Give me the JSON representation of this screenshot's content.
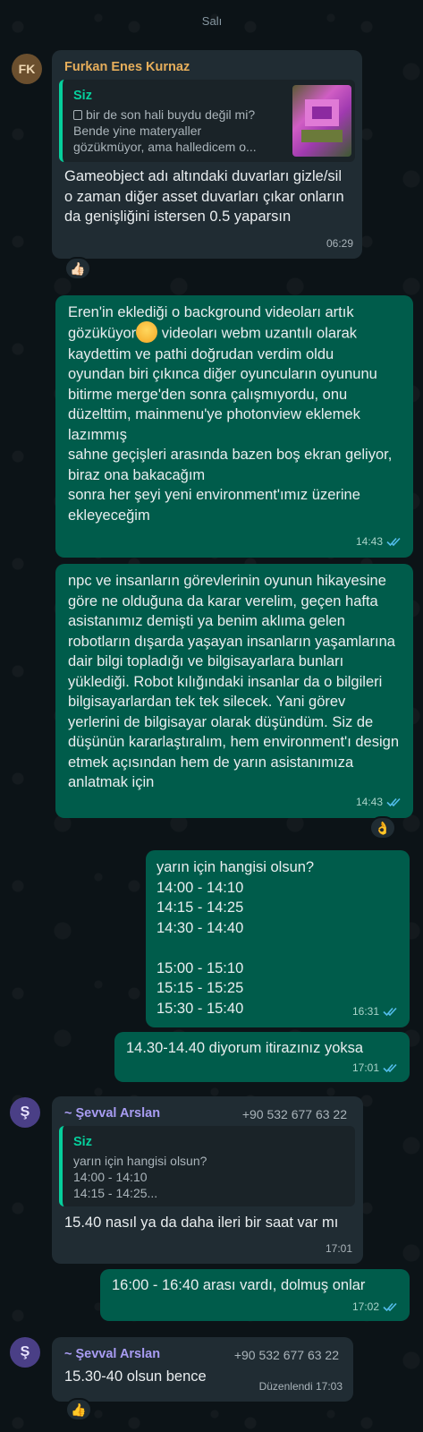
{
  "date_separator": "Salı",
  "colors": {
    "incoming": "#202c33",
    "outgoing": "#005c4b",
    "background": "#0c1317",
    "read_ticks": "#53bdeb"
  },
  "msg1": {
    "avatar_initials": "FK",
    "sender": "Furkan Enes Kurnaz",
    "quote": {
      "name": "Siz",
      "icon": "document-icon",
      "text": "bir de son hali buydu değil mi? Bende yine materyaller gözükmüyor, ama halledicem o..."
    },
    "text": "Gameobject adı altındaki duvarları gizle/sil o zaman diğer asset duvarları çıkar onların da genişliğini istersen 0.5 yaparsın",
    "time": "06:29",
    "reaction": "👍🏻"
  },
  "msg2": {
    "text_before_emoji": "Eren'in eklediği o background videoları artık gözüküyor",
    "text_after_emoji": " videoları webm uzantılı olarak kaydettim ve pathi doğrudan verdim oldu\noyundan biri çıkınca diğer oyuncuların oyununu bitirme merge'den sonra çalışmıyordu, onu düzelttim, mainmenu'ye photonview eklemek lazımmış\nsahne geçişleri arasında bazen boş ekran geliyor, biraz ona bakacağım\nsonra her şeyi yeni environment'ımız üzerine ekleyeceğim",
    "time": "14:43"
  },
  "msg3": {
    "text": "npc ve insanların görevlerinin oyunun hikayesine göre ne olduğuna da karar verelim, geçen hafta asistanımız demişti ya benim aklıma gelen robotların dışarda yaşayan insanların yaşamlarına dair bilgi topladığı ve bilgisayarlara bunları yüklediği. Robot kılığındaki insanlar da o bilgileri bilgisayarlardan tek tek silecek. Yani görev yerlerini de bilgisayar olarak düşündüm. Siz de düşünün kararlaştıralım, hem environment'ı design etmek açısından hem de yarın asistanımıza anlatmak için",
    "time": "14:43",
    "reaction": "👌"
  },
  "msg4": {
    "text": "yarın için hangisi olsun?\n14:00 - 14:10\n14:15 - 14:25\n14:30 - 14:40\n\n15:00 - 15:10\n15:15 - 15:25\n15:30 - 15:40",
    "time": "16:31"
  },
  "msg5": {
    "text": "14.30-14.40 diyorum itirazınız yoksa",
    "time": "17:01"
  },
  "msg6": {
    "avatar_initials": "Ş",
    "sender": "~ Şevval Arslan",
    "phone": "+90 532 677 63 22",
    "quote": {
      "name": "Siz",
      "text": "yarın için hangisi olsun?\n14:00 - 14:10\n14:15 - 14:25..."
    },
    "text": "15.40 nasıl ya da daha ileri bir saat var mı",
    "time": "17:01"
  },
  "msg7": {
    "text": "16:00 - 16:40 arası vardı, dolmuş onlar",
    "time": "17:02"
  },
  "msg8": {
    "avatar_initials": "Ş",
    "sender": "~ Şevval Arslan",
    "phone": "+90 532 677 63 22",
    "text": "15.30-40 olsun bence",
    "edited_time": "Düzenlendi 17:03",
    "reaction": "👍"
  }
}
